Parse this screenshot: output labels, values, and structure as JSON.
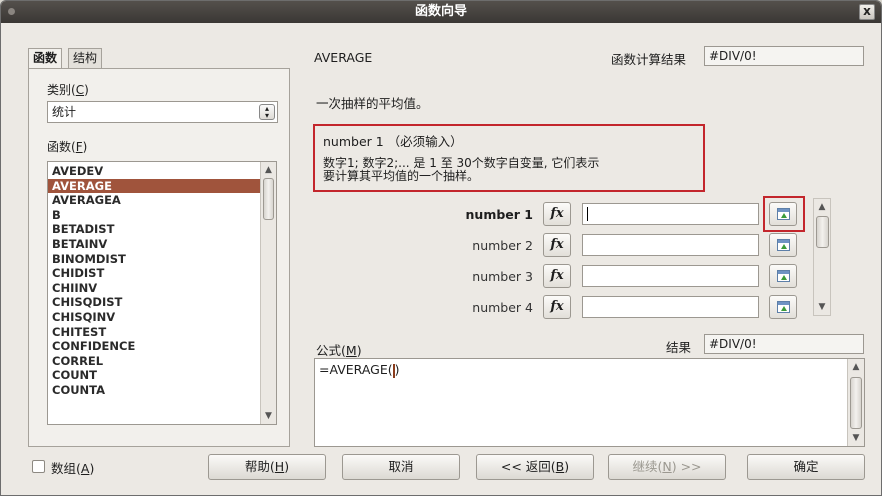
{
  "window": {
    "title": "函数向导",
    "close": "x"
  },
  "tabs": [
    {
      "label": "函数",
      "active": true
    },
    {
      "label": "结构",
      "active": false
    }
  ],
  "category": {
    "label_prefix": "类别(",
    "label_key": "C",
    "label_suffix": ")",
    "value": "统计"
  },
  "functions": {
    "label_prefix": "函数(",
    "label_key": "F",
    "label_suffix": ")",
    "items": [
      "AVEDEV",
      "AVERAGE",
      "AVERAGEA",
      "B",
      "BETADIST",
      "BETAINV",
      "BINOMDIST",
      "CHIDIST",
      "CHIINV",
      "CHISQDIST",
      "CHISQINV",
      "CHITEST",
      "CONFIDENCE",
      "CORREL",
      "COUNT",
      "COUNTA"
    ],
    "selected": "AVERAGE"
  },
  "details": {
    "function_name": "AVERAGE",
    "result_label": "函数计算结果",
    "result_value": "#DIV/0!",
    "description": "一次抽样的平均值。",
    "arg_title": "number 1 （必须输入）",
    "arg_desc_line1": "数字1; 数字2;... 是 1 至 30个数字自变量, 它们表示",
    "arg_desc_line2": "要计算其平均值的一个抽样。"
  },
  "arguments": [
    {
      "label": "number 1",
      "bold": true,
      "value": ""
    },
    {
      "label": "number 2",
      "bold": false,
      "value": ""
    },
    {
      "label": "number 3",
      "bold": false,
      "value": ""
    },
    {
      "label": "number 4",
      "bold": false,
      "value": ""
    }
  ],
  "fx_glyph": "fx",
  "formula": {
    "label_prefix": "公式(",
    "label_key": "M",
    "label_suffix": ")",
    "value_before_cursor": "=AVERAGE(",
    "value_after_cursor": ")",
    "result_label": "结果",
    "result_value": "#DIV/0!"
  },
  "footer": {
    "array_prefix": "数组(",
    "array_key": "A",
    "array_suffix": ")",
    "help_prefix": "帮助(",
    "help_key": "H",
    "help_suffix": ")",
    "cancel": "取消",
    "back_prefix": "<< 返回(",
    "back_key": "B",
    "back_suffix": ")",
    "next_prefix": "继续(",
    "next_key": "N",
    "next_suffix": ") >>",
    "ok": "确定"
  },
  "icons": {
    "fx": "function-icon",
    "pick": "shrink-select-icon",
    "spin": "spin-arrows-icon"
  }
}
